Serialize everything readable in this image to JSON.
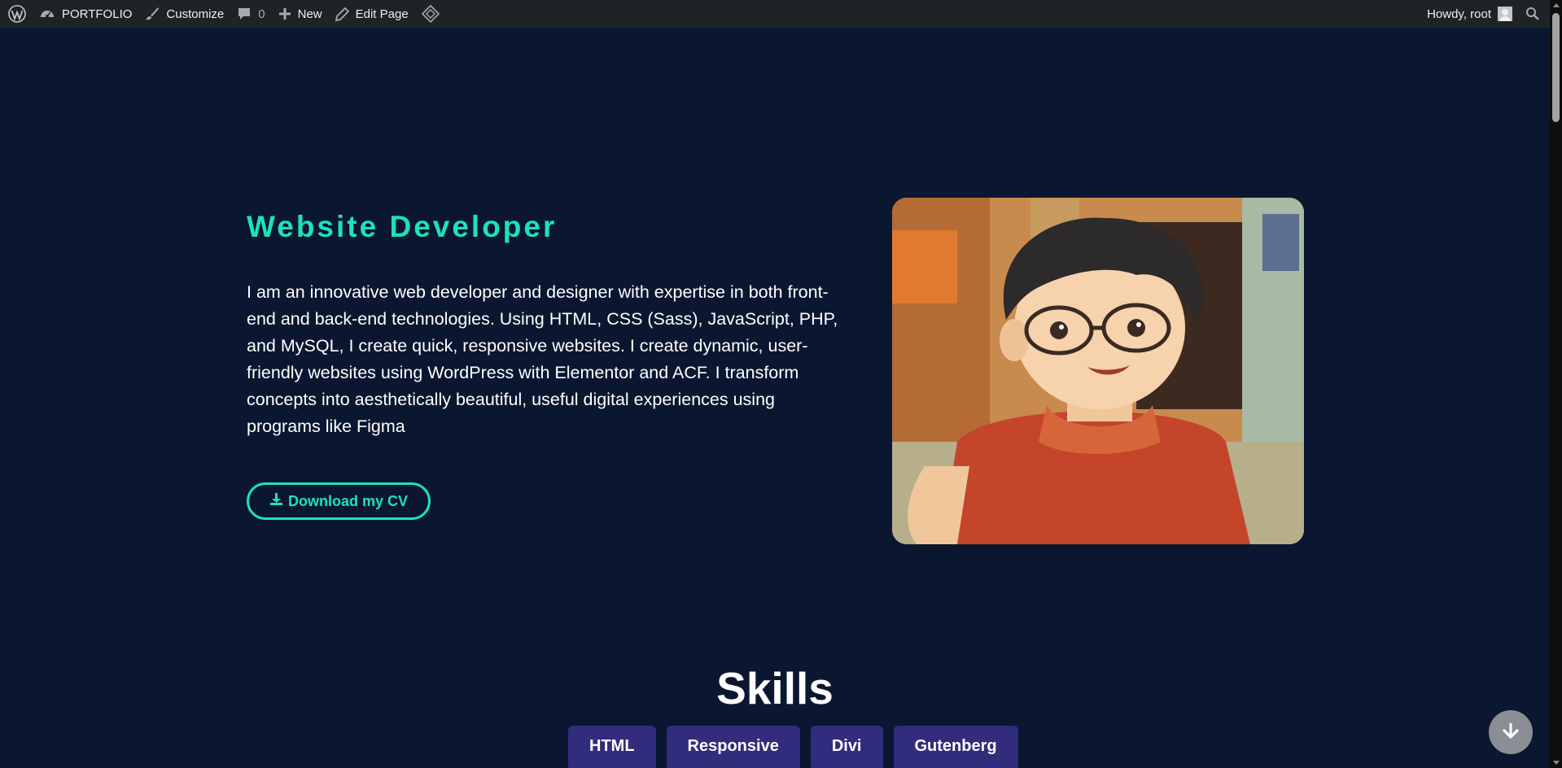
{
  "adminbar": {
    "site_name": "PORTFOLIO",
    "customize": "Customize",
    "comments_count": "0",
    "new": "New",
    "edit_page": "Edit Page",
    "howdy": "Howdy, root"
  },
  "hero": {
    "title": "Website Developer",
    "text": "I am an innovative web developer and designer with expertise in both front-end and back-end technologies. Using HTML, CSS (Sass), JavaScript, PHP, and MySQL, I create quick, responsive websites. I create dynamic, user-friendly websites using WordPress with Elementor and ACF. I transform concepts into aesthetically beautiful, useful digital experiences using programs like Figma",
    "cv_button": "Download my CV"
  },
  "skills": {
    "title": "Skills",
    "items": [
      "HTML",
      "Responsive",
      "Divi",
      "Gutenberg"
    ]
  },
  "colors": {
    "background": "#0b1730",
    "accent": "#1de2b8",
    "skill_bg": "#322c7c",
    "adminbar_bg": "#1d2327"
  }
}
